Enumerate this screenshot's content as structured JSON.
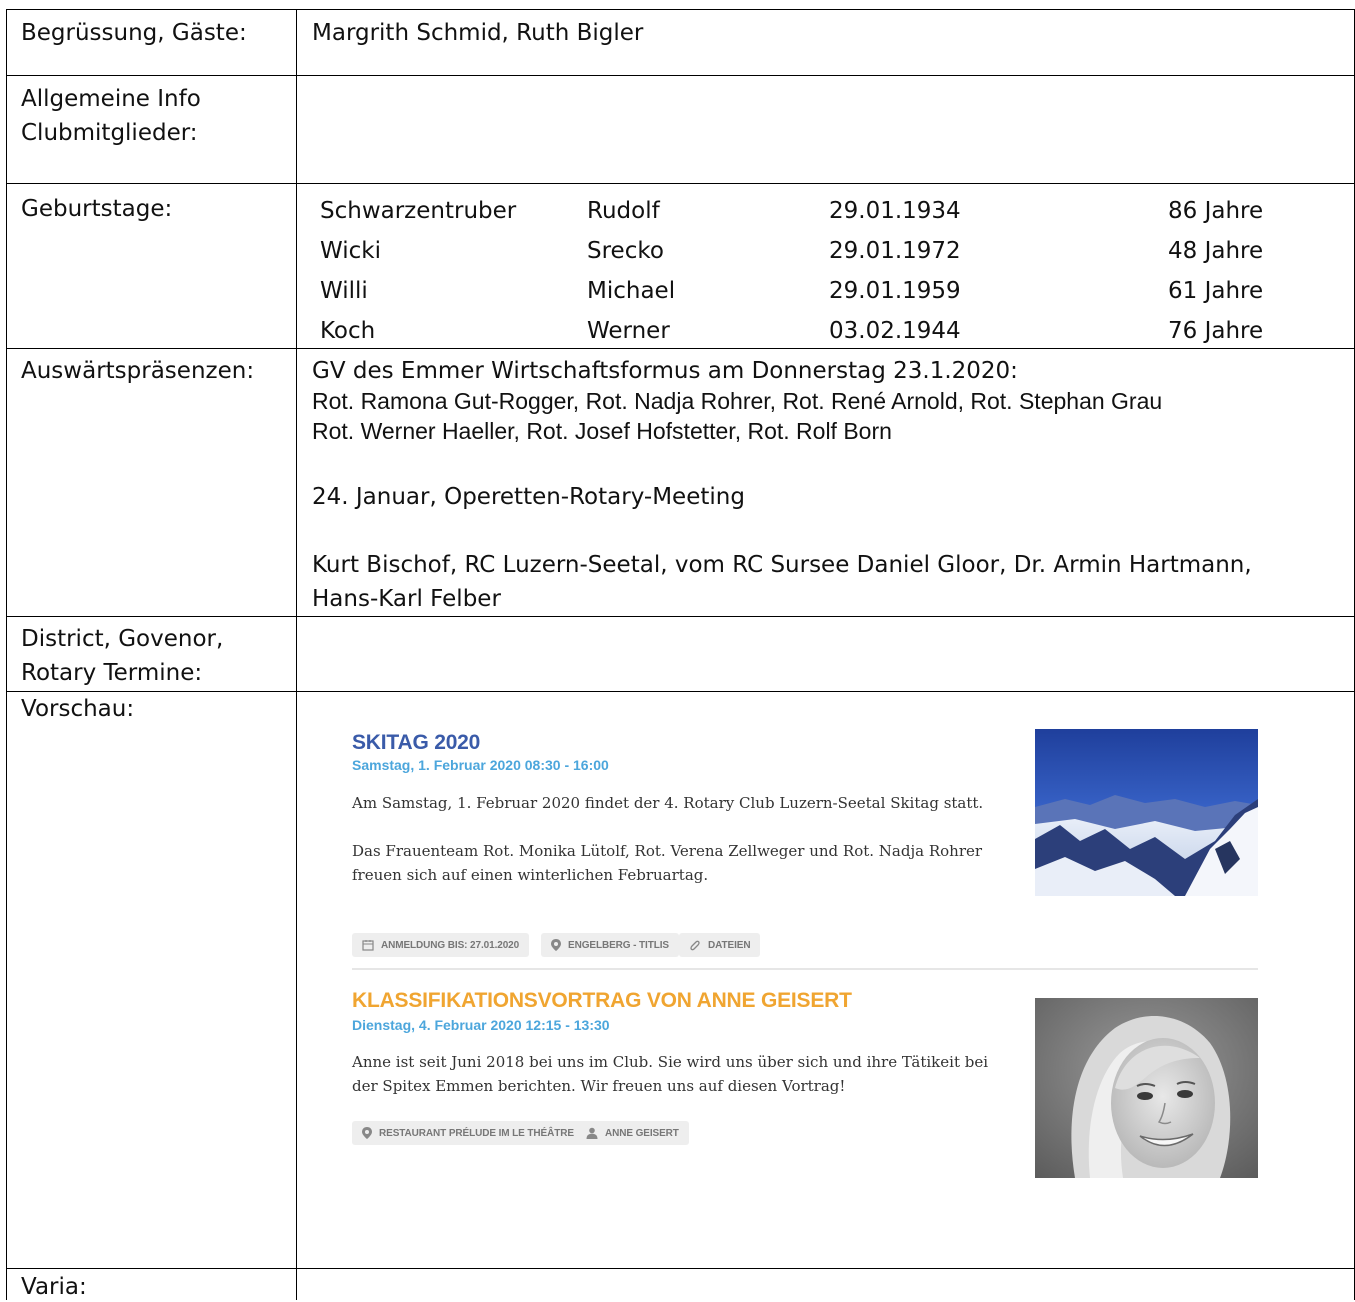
{
  "rows": {
    "begruessung": {
      "label": "Begrüssung, Gäste:",
      "value": "Margrith Schmid, Ruth Bigler"
    },
    "allgemein": {
      "label_line1": "Allgemeine Info",
      "label_line2": "Clubmitglieder:"
    },
    "geburtstage": {
      "label": "Geburtstage:",
      "entries": [
        {
          "name": "Schwarzentruber",
          "vorname": "Rudolf",
          "datum": "29.01.1934",
          "alter": "86 Jahre"
        },
        {
          "name": "Wicki",
          "vorname": "Srecko",
          "datum": "29.01.1972",
          "alter": "48 Jahre"
        },
        {
          "name": "Willi",
          "vorname": "Michael",
          "datum": "29.01.1959",
          "alter": "61 Jahre"
        },
        {
          "name": "Koch",
          "vorname": "Werner",
          "datum": "03.02.1944",
          "alter": "76 Jahre"
        }
      ]
    },
    "auswaerts": {
      "label": "Auswärtspräsenzen:",
      "line1": "GV des Emmer Wirtschaftsformus am Donnerstag 23.1.2020:",
      "line2": "Rot. Ramona Gut-Rogger,  Rot. Nadja Rohrer, Rot. René Arnold, Rot. Stephan Grau",
      "line3": "Rot. Werner Haeller, Rot. Josef Hofstetter, Rot. Rolf Born",
      "line4": "24. Januar, Operetten-Rotary-Meeting",
      "line5": "Kurt Bischof, RC Luzern-Seetal,  vom RC Sursee Daniel Gloor, Dr. Armin Hartmann,",
      "line6": "Hans-Karl Felber"
    },
    "district": {
      "label_line1": "District, Govenor,",
      "label_line2": "Rotary Termine:"
    },
    "vorschau": {
      "label": "Vorschau:",
      "events": [
        {
          "title": "SKITAG 2020",
          "title_color": "#3a5ba9",
          "date": "Samstag, 1. Februar 2020 08:30 - 16:00",
          "date_color": "#4ca6dc",
          "text1": "Am Samstag, 1. Februar 2020 findet der 4. Rotary Club Luzern-Seetal Skitag statt.",
          "text2": "Das Frauenteam Rot. Monika Lütolf, Rot. Verena Zellweger und Rot. Nadja Rohrer freuen sich auf  einen winterlichen Februartag.",
          "tags": [
            "ANMELDUNG BIS: 27.01.2020",
            "ENGELBERG - TITLIS",
            "DATEIEN"
          ],
          "tag_icons": [
            "calendar-icon",
            "map-pin-icon",
            "paperclip-icon"
          ]
        },
        {
          "title": "KLASSIFIKATIONSVORTRAG VON ANNE GEISERT",
          "title_color": "#f0a531",
          "date": "Dienstag, 4. Februar 2020 12:15 - 13:30",
          "date_color": "#4ca6dc",
          "text1": "Anne ist seit Juni 2018 bei uns im Club. Sie wird uns über sich und ihre Tätikeit bei der Spitex Emmen berichten. Wir freuen uns auf diesen Vortrag!",
          "tags": [
            "RESTAURANT PRÉLUDE IM LE THÉÂTRE",
            "ANNE GEISERT"
          ],
          "tag_icons": [
            "map-pin-icon",
            "user-icon"
          ]
        }
      ]
    },
    "varia": {
      "label": "Varia:"
    }
  }
}
